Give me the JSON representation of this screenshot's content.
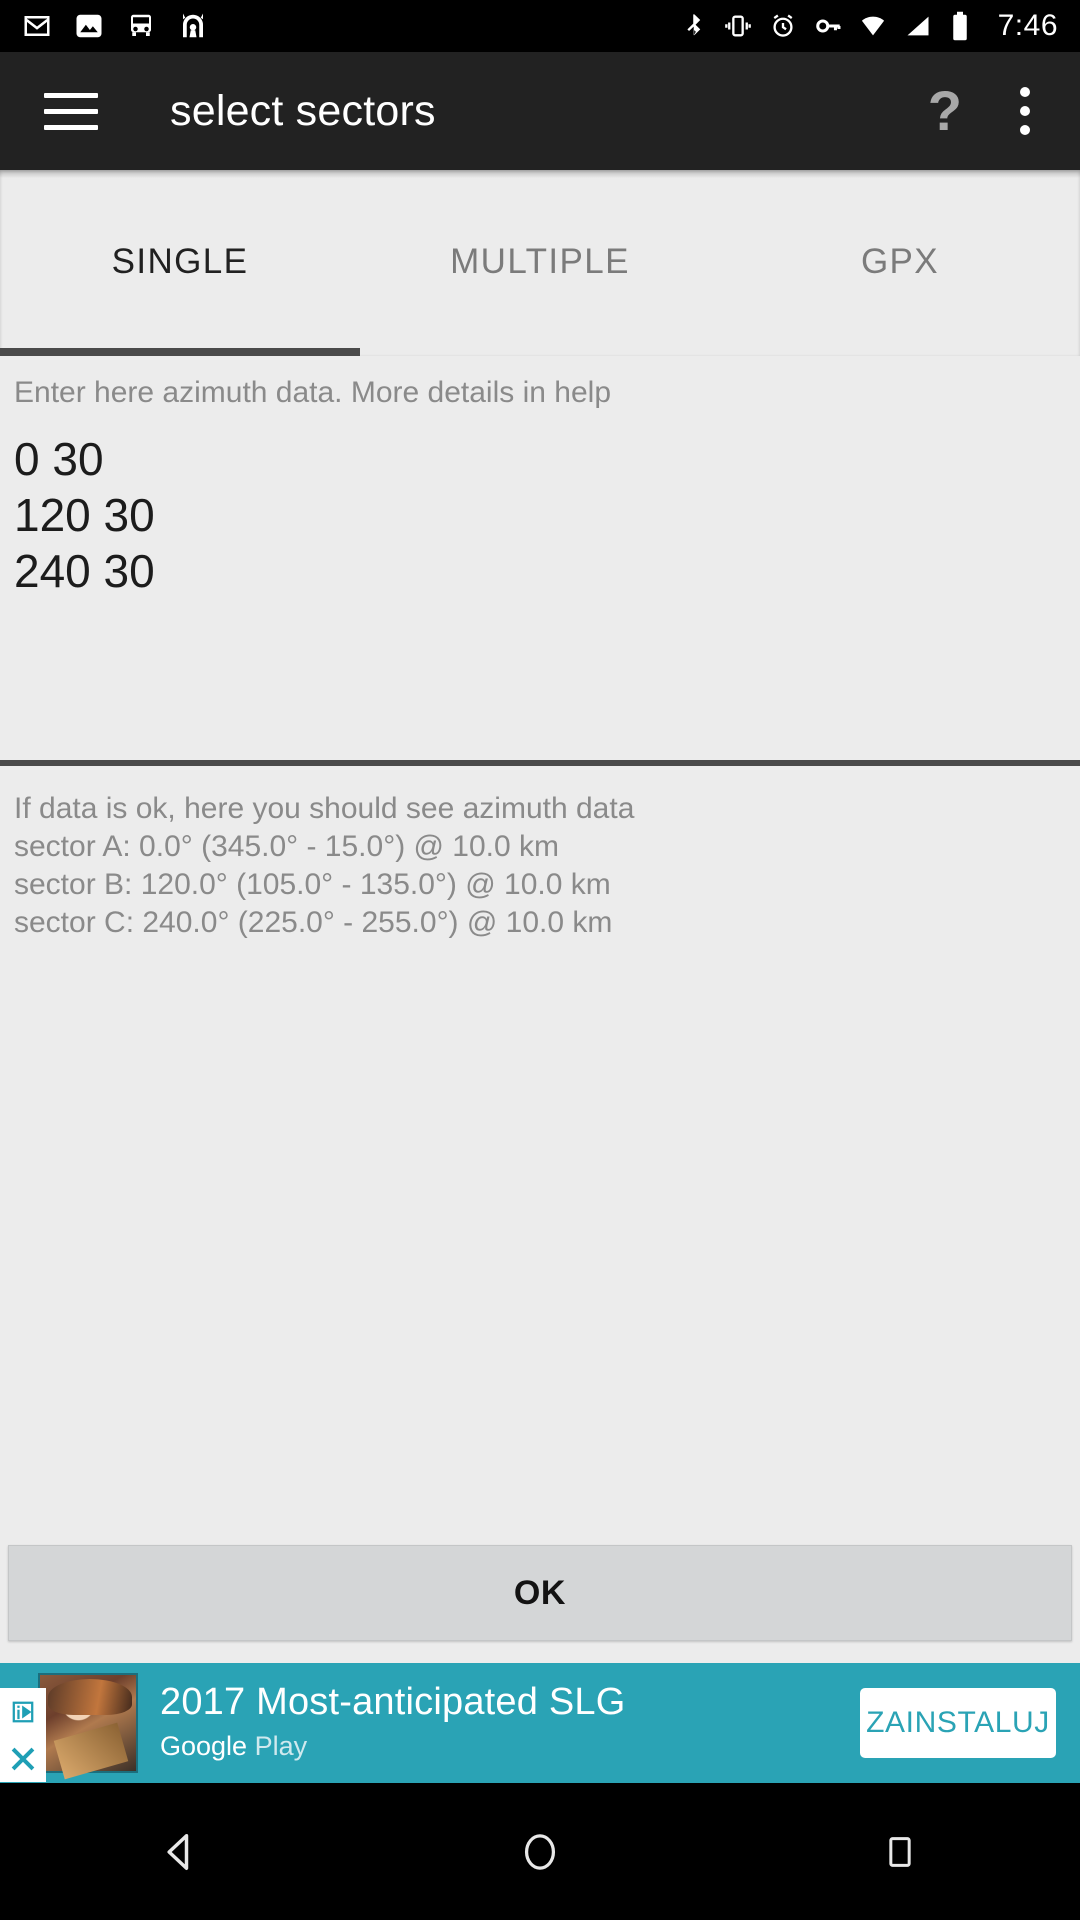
{
  "statusbar": {
    "icons_left": [
      "gmail-icon",
      "photos-icon",
      "bus-icon",
      "app-icon"
    ],
    "icons_right": [
      "bluetooth-icon",
      "vibrate-icon",
      "alarm-icon",
      "vpn-key-icon",
      "wifi-icon",
      "signal-icon",
      "battery-icon"
    ],
    "clock": "7:46"
  },
  "appbar": {
    "menu_icon": "hamburger-icon",
    "title": "select sectors",
    "help_label": "?",
    "overflow_icon": "kebab-menu-icon"
  },
  "tabs": [
    {
      "label": "SINGLE",
      "active": true
    },
    {
      "label": "MULTIPLE",
      "active": false
    },
    {
      "label": "GPX",
      "active": false
    }
  ],
  "input": {
    "hint": "Enter here azimuth data. More details in help",
    "value": "0 30\n120 30\n240 30",
    "placeholder": "Enter here azimuth data. More details in help"
  },
  "results": {
    "header": "If data is ok, here you should see azimuth data",
    "lines": [
      "sector A: 0.0° (345.0° - 15.0°) @ 10.0 km",
      "sector B: 120.0° (105.0° - 135.0°) @ 10.0 km",
      "sector C: 240.0° (225.0° - 255.0°) @ 10.0 km"
    ]
  },
  "ok_button": {
    "label": "OK"
  },
  "ad": {
    "title": "2017 Most-anticipated SLG",
    "source_google": "Google",
    "source_play": "Play",
    "cta_label": "ZAINSTALUJ",
    "adchoices_icon": "adchoices-icon",
    "close_icon": "close-icon",
    "background_color": "#2aa3b5"
  },
  "navbar": {
    "back": "back-triangle-icon",
    "home": "home-circle-icon",
    "recents": "recents-square-icon"
  },
  "colors": {
    "appbar": "#222222",
    "background": "#ececec",
    "accent": "#4a4a4a",
    "ad_teal": "#2aa3b5"
  }
}
